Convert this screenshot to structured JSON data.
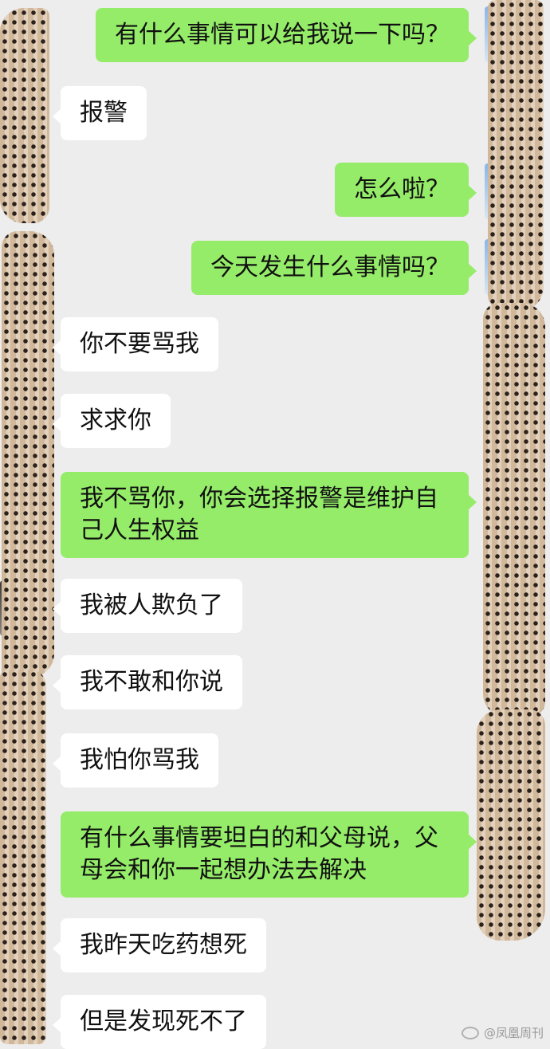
{
  "messages": [
    {
      "side": "out",
      "text": "有什么事情可以给我说一下吗？"
    },
    {
      "side": "in",
      "text": "报警"
    },
    {
      "side": "out",
      "text": "怎么啦？"
    },
    {
      "side": "out",
      "text": "今天发生什么事情吗？"
    },
    {
      "side": "in",
      "text": "你不要骂我"
    },
    {
      "side": "in",
      "text": "求求你"
    },
    {
      "side": "out",
      "text": "我不骂你，你会选择报警是维护自己人生权益"
    },
    {
      "side": "in",
      "text": "我被人欺负了"
    },
    {
      "side": "in",
      "text": "我不敢和你说"
    },
    {
      "side": "in",
      "text": "我怕你骂我"
    },
    {
      "side": "out",
      "text": "有什么事情要坦白的和父母说，父母会和你一起想办法去解决"
    },
    {
      "side": "in",
      "text": "我昨天吃药想死"
    },
    {
      "side": "in",
      "text": "但是发现死不了"
    }
  ],
  "watermark": {
    "text": "@凤凰周刊",
    "icon": "weibo-icon"
  },
  "colors": {
    "background": "#ededed",
    "outgoing_bubble": "#95ec69",
    "incoming_bubble": "#ffffff"
  }
}
